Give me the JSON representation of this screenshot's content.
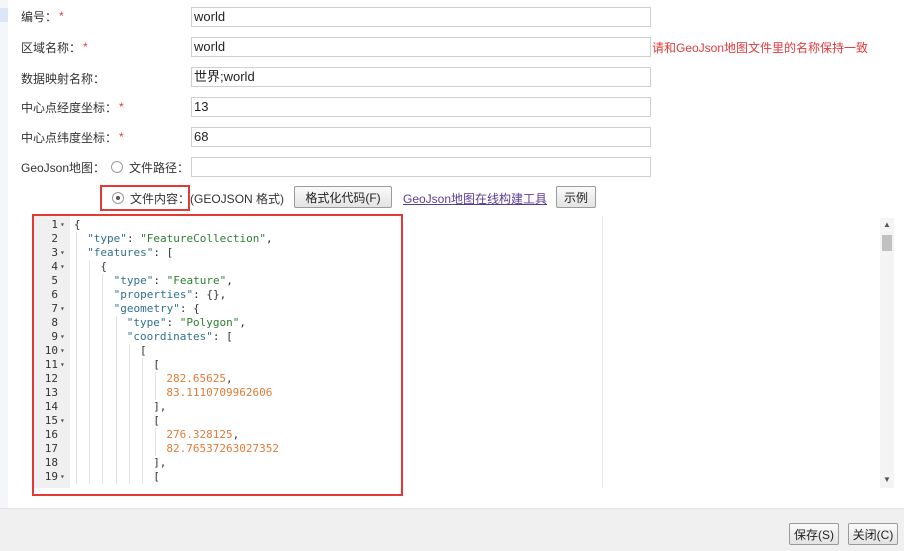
{
  "form": {
    "code_label": "编号：",
    "code_value": "world",
    "region_label": "区域名称：",
    "region_value": "world",
    "region_hint": "请和GeoJson地图文件里的名称保持一致",
    "mapping_label": "数据映射名称：",
    "mapping_value": "世界;world",
    "lng_label": "中心点经度坐标：",
    "lng_value": "13",
    "lat_label": "中心点纬度坐标：",
    "lat_value": "68",
    "geojson_label": "GeoJson地图：",
    "file_path_label": "文件路径：",
    "file_path_value": "",
    "file_content_label": "文件内容：",
    "geojson_format": "(GEOJSON 格式)",
    "required_mark": "*"
  },
  "toolbar": {
    "format_button": "格式化代码(F)",
    "online_tool_link": "GeoJson地图在线构建工具",
    "example_button": "示例"
  },
  "editor": {
    "lines": [
      {
        "n": "1",
        "fold": true,
        "indent": 0,
        "tokens": [
          {
            "t": "p",
            "v": "{"
          }
        ]
      },
      {
        "n": "2",
        "fold": false,
        "indent": 1,
        "tokens": [
          {
            "t": "k",
            "v": "\"type\""
          },
          {
            "t": "p",
            "v": ": "
          },
          {
            "t": "s",
            "v": "\"FeatureCollection\""
          },
          {
            "t": "p",
            "v": ","
          }
        ]
      },
      {
        "n": "3",
        "fold": true,
        "indent": 1,
        "tokens": [
          {
            "t": "k",
            "v": "\"features\""
          },
          {
            "t": "p",
            "v": ": ["
          }
        ]
      },
      {
        "n": "4",
        "fold": true,
        "indent": 2,
        "tokens": [
          {
            "t": "p",
            "v": "{"
          }
        ]
      },
      {
        "n": "5",
        "fold": false,
        "indent": 3,
        "tokens": [
          {
            "t": "k",
            "v": "\"type\""
          },
          {
            "t": "p",
            "v": ": "
          },
          {
            "t": "s",
            "v": "\"Feature\""
          },
          {
            "t": "p",
            "v": ","
          }
        ]
      },
      {
        "n": "6",
        "fold": false,
        "indent": 3,
        "tokens": [
          {
            "t": "k",
            "v": "\"properties\""
          },
          {
            "t": "p",
            "v": ": {},"
          }
        ]
      },
      {
        "n": "7",
        "fold": true,
        "indent": 3,
        "tokens": [
          {
            "t": "k",
            "v": "\"geometry\""
          },
          {
            "t": "p",
            "v": ": {"
          }
        ]
      },
      {
        "n": "8",
        "fold": false,
        "indent": 4,
        "tokens": [
          {
            "t": "k",
            "v": "\"type\""
          },
          {
            "t": "p",
            "v": ": "
          },
          {
            "t": "s",
            "v": "\"Polygon\""
          },
          {
            "t": "p",
            "v": ","
          }
        ]
      },
      {
        "n": "9",
        "fold": true,
        "indent": 4,
        "tokens": [
          {
            "t": "k",
            "v": "\"coordinates\""
          },
          {
            "t": "p",
            "v": ": ["
          }
        ]
      },
      {
        "n": "10",
        "fold": true,
        "indent": 5,
        "tokens": [
          {
            "t": "p",
            "v": "["
          }
        ]
      },
      {
        "n": "11",
        "fold": true,
        "indent": 6,
        "tokens": [
          {
            "t": "p",
            "v": "["
          }
        ]
      },
      {
        "n": "12",
        "fold": false,
        "indent": 7,
        "tokens": [
          {
            "t": "n",
            "v": "282.65625"
          },
          {
            "t": "p",
            "v": ","
          }
        ]
      },
      {
        "n": "13",
        "fold": false,
        "indent": 7,
        "tokens": [
          {
            "t": "n",
            "v": "83.1110709962606"
          }
        ]
      },
      {
        "n": "14",
        "fold": false,
        "indent": 6,
        "tokens": [
          {
            "t": "p",
            "v": "],"
          }
        ]
      },
      {
        "n": "15",
        "fold": true,
        "indent": 6,
        "tokens": [
          {
            "t": "p",
            "v": "["
          }
        ]
      },
      {
        "n": "16",
        "fold": false,
        "indent": 7,
        "tokens": [
          {
            "t": "n",
            "v": "276.328125"
          },
          {
            "t": "p",
            "v": ","
          }
        ]
      },
      {
        "n": "17",
        "fold": false,
        "indent": 7,
        "tokens": [
          {
            "t": "n",
            "v": "82.76537263027352"
          }
        ]
      },
      {
        "n": "18",
        "fold": false,
        "indent": 6,
        "tokens": [
          {
            "t": "p",
            "v": "],"
          }
        ]
      },
      {
        "n": "19",
        "fold": true,
        "indent": 6,
        "tokens": [
          {
            "t": "p",
            "v": "["
          }
        ]
      }
    ]
  },
  "footer": {
    "save_button": "保存(S)",
    "close_button": "关闭(C)"
  },
  "icons": {
    "fold": "▾",
    "scroll_up": "▲",
    "scroll_down": "▼"
  },
  "colors": {
    "required": "#e4393c",
    "highlight_border": "#e53935",
    "json_key": "#31708f",
    "json_string": "#2e7d32",
    "json_number": "#e07b39"
  }
}
